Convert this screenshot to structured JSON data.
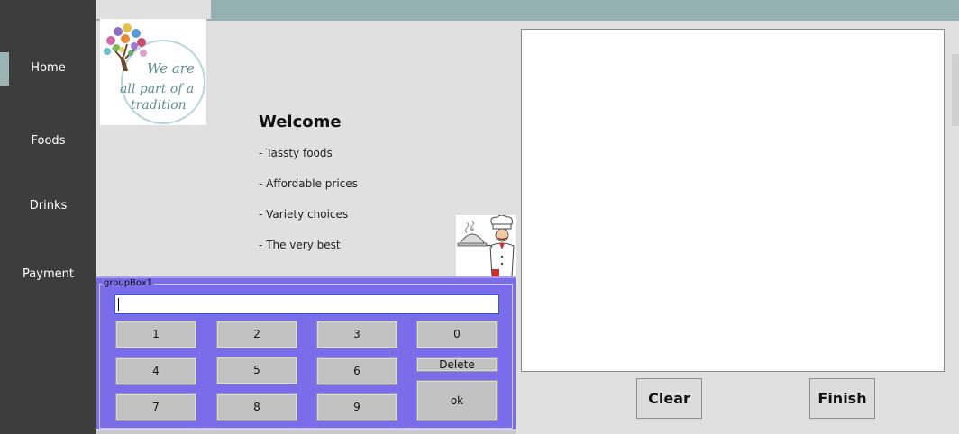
{
  "sidebar": {
    "items": [
      {
        "label": "Home"
      },
      {
        "label": "Foods"
      },
      {
        "label": "Drinks"
      },
      {
        "label": "Payment"
      }
    ],
    "active": "Home",
    "accent_color": "#9cb4b4"
  },
  "logo": {
    "text_lines": [
      "We are",
      "all part of a",
      "tradition"
    ],
    "alt": "tree-logo"
  },
  "welcome": {
    "title": "Welcome",
    "bullets": [
      "- Tassty foods",
      "- Affordable prices",
      "- Variety choices",
      "- The very best"
    ]
  },
  "groupbox": {
    "legend": "groupBox1",
    "input_value": "",
    "background_color": "#7b6cea",
    "keys": {
      "k1": "1",
      "k2": "2",
      "k3": "3",
      "k0": "0",
      "k4": "4",
      "k5": "5",
      "k6": "6",
      "delete": "Delete",
      "k7": "7",
      "k8": "8",
      "k9": "9",
      "ok": "ok"
    }
  },
  "actions": {
    "clear": "Clear",
    "finish": "Finish"
  }
}
